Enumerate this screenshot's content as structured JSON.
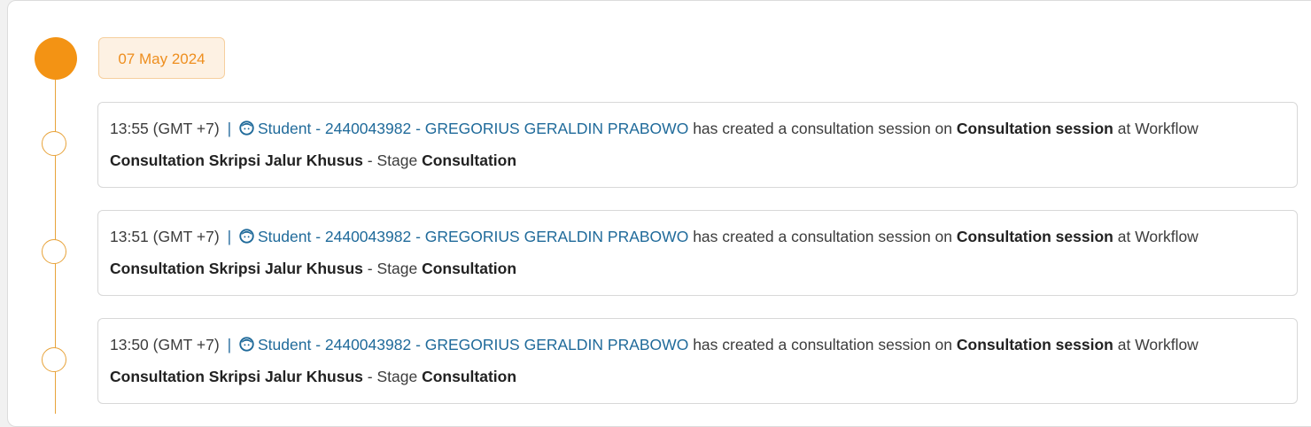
{
  "date": "07 May 2024",
  "entries": [
    {
      "time": "13:55 (GMT +7)",
      "separator": "|",
      "student_icon": "student-face-icon",
      "student": "Student - 2440043982 - GREGORIUS GERALDIN PRABOWO",
      "action": "has created a consultation session on",
      "session": "Consultation session",
      "at_workflow": "at Workflow",
      "workflow": "Consultation Skripsi Jalur Khusus",
      "stage_label": "- Stage",
      "stage": "Consultation"
    },
    {
      "time": "13:51 (GMT +7)",
      "separator": "|",
      "student_icon": "student-face-icon",
      "student": "Student - 2440043982 - GREGORIUS GERALDIN PRABOWO",
      "action": "has created a consultation session on",
      "session": "Consultation session",
      "at_workflow": "at Workflow",
      "workflow": "Consultation Skripsi Jalur Khusus",
      "stage_label": "- Stage",
      "stage": "Consultation"
    },
    {
      "time": "13:50 (GMT +7)",
      "separator": "|",
      "student_icon": "student-face-icon",
      "student": "Student - 2440043982 - GREGORIUS GERALDIN PRABOWO",
      "action": "has created a consultation session on",
      "session": "Consultation session",
      "at_workflow": "at Workflow",
      "workflow": "Consultation Skripsi Jalur Khusus",
      "stage_label": "- Stage",
      "stage": "Consultation"
    }
  ],
  "colors": {
    "accent": "#f39314",
    "date_text": "#ee8e1e",
    "link": "#1f6a9a"
  }
}
